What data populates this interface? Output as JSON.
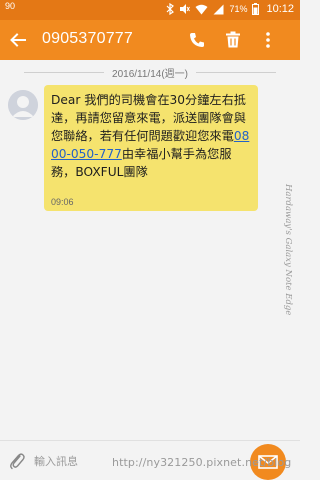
{
  "status_bar": {
    "left_note": "90",
    "battery_percent": "71%",
    "time": "10:12"
  },
  "app_bar": {
    "title": "0905370777",
    "icons": [
      "back-arrow-icon",
      "phone-icon",
      "trash-icon",
      "more-vert-icon"
    ]
  },
  "conversation": {
    "date": "2016/11/14(週一)",
    "message": {
      "text_before_link": "Dear 我們的司機會在30分鐘左右抵達，再請您留意來電，派送團隊會與您聯絡，若有任何問題歡迎您來電",
      "link": "0800-050-777",
      "text_after_link": "由幸福小幫手為您服務，BOXFUL團隊",
      "time": "09:06"
    }
  },
  "side_watermark": "Hardaway's Galaxy Note Edge",
  "input": {
    "placeholder": "輸入訊息"
  },
  "url_watermark": "http://ny321250.pixnet.net/blog",
  "colors": {
    "status_bar": "#e47815",
    "app_bar": "#f18a1f",
    "bubble": "#f5e36e",
    "link": "#2462c7",
    "send_button": "#f18a1f"
  }
}
